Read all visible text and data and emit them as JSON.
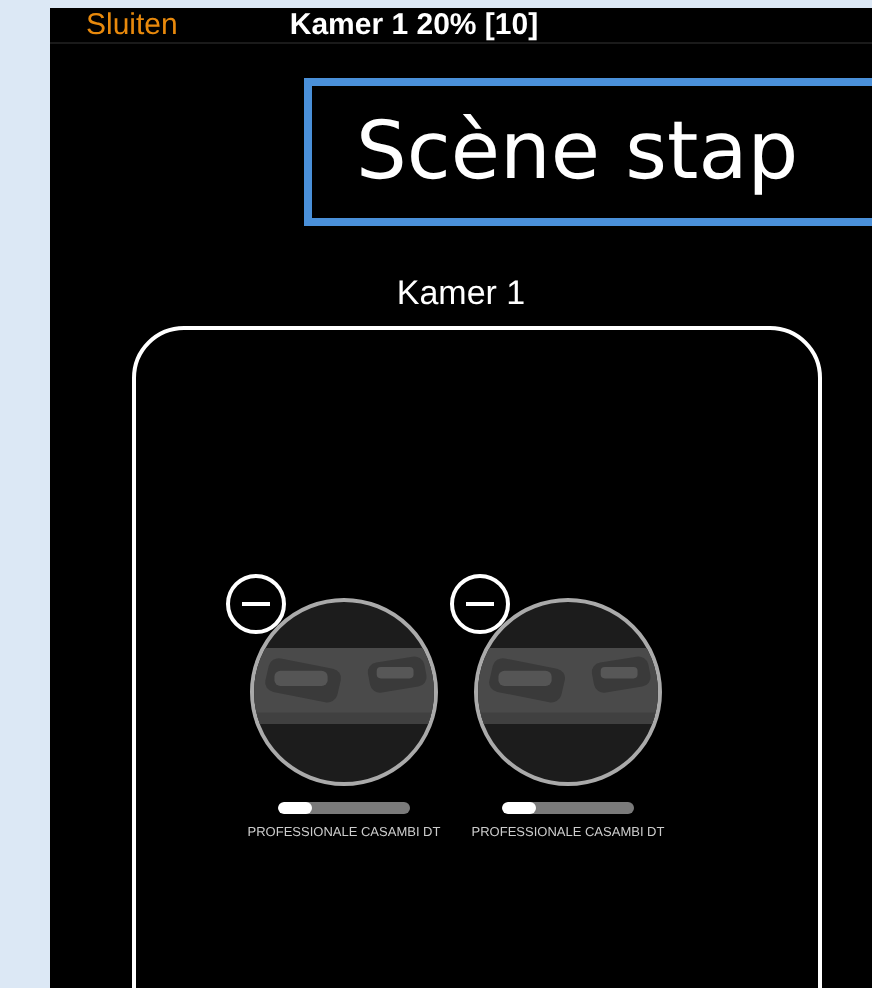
{
  "header": {
    "close_button": "Sluiten",
    "title": "Kamer 1 20% [10]"
  },
  "scene_title": "Scène stap",
  "room": {
    "name": "Kamer 1",
    "devices": [
      {
        "name": "PROFESSIONALE CASAMBI DT",
        "level": 0.25
      },
      {
        "name": "PROFESSIONALE CASAMBI DT",
        "level": 0.25
      }
    ]
  }
}
